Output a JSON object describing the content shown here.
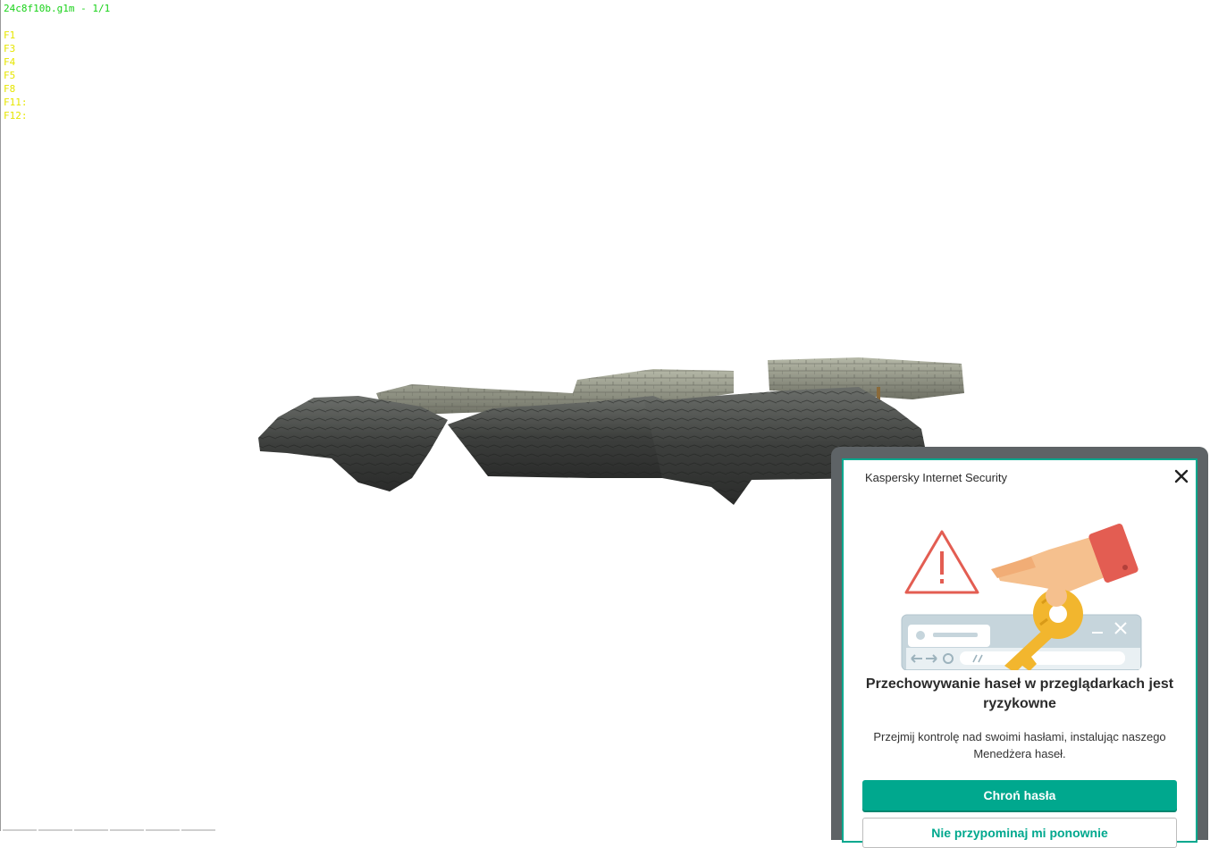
{
  "viewer": {
    "file_label": "24c8f10b.g1m - 1/1",
    "keys": [
      "F1",
      "F3",
      "F4",
      "F5",
      "F8",
      "F11:",
      "F12:"
    ]
  },
  "toast": {
    "app_name": "Kaspersky Internet Security",
    "headline": "Przechowywanie haseł w przeglądarkach jest ryzykowne",
    "body": "Przejmij kontrolę nad swoimi hasłami, instalując naszego Menedżera haseł.",
    "primary_button": "Chroń hasła",
    "secondary_button": "Nie przypominaj mi ponownie",
    "colors": {
      "accent": "#00a88e",
      "warning": "#e35d52",
      "key": "#f2b62e"
    },
    "icons": [
      "close-icon",
      "warning-triangle-icon",
      "hand-with-key-icon",
      "browser-window-icon"
    ]
  }
}
